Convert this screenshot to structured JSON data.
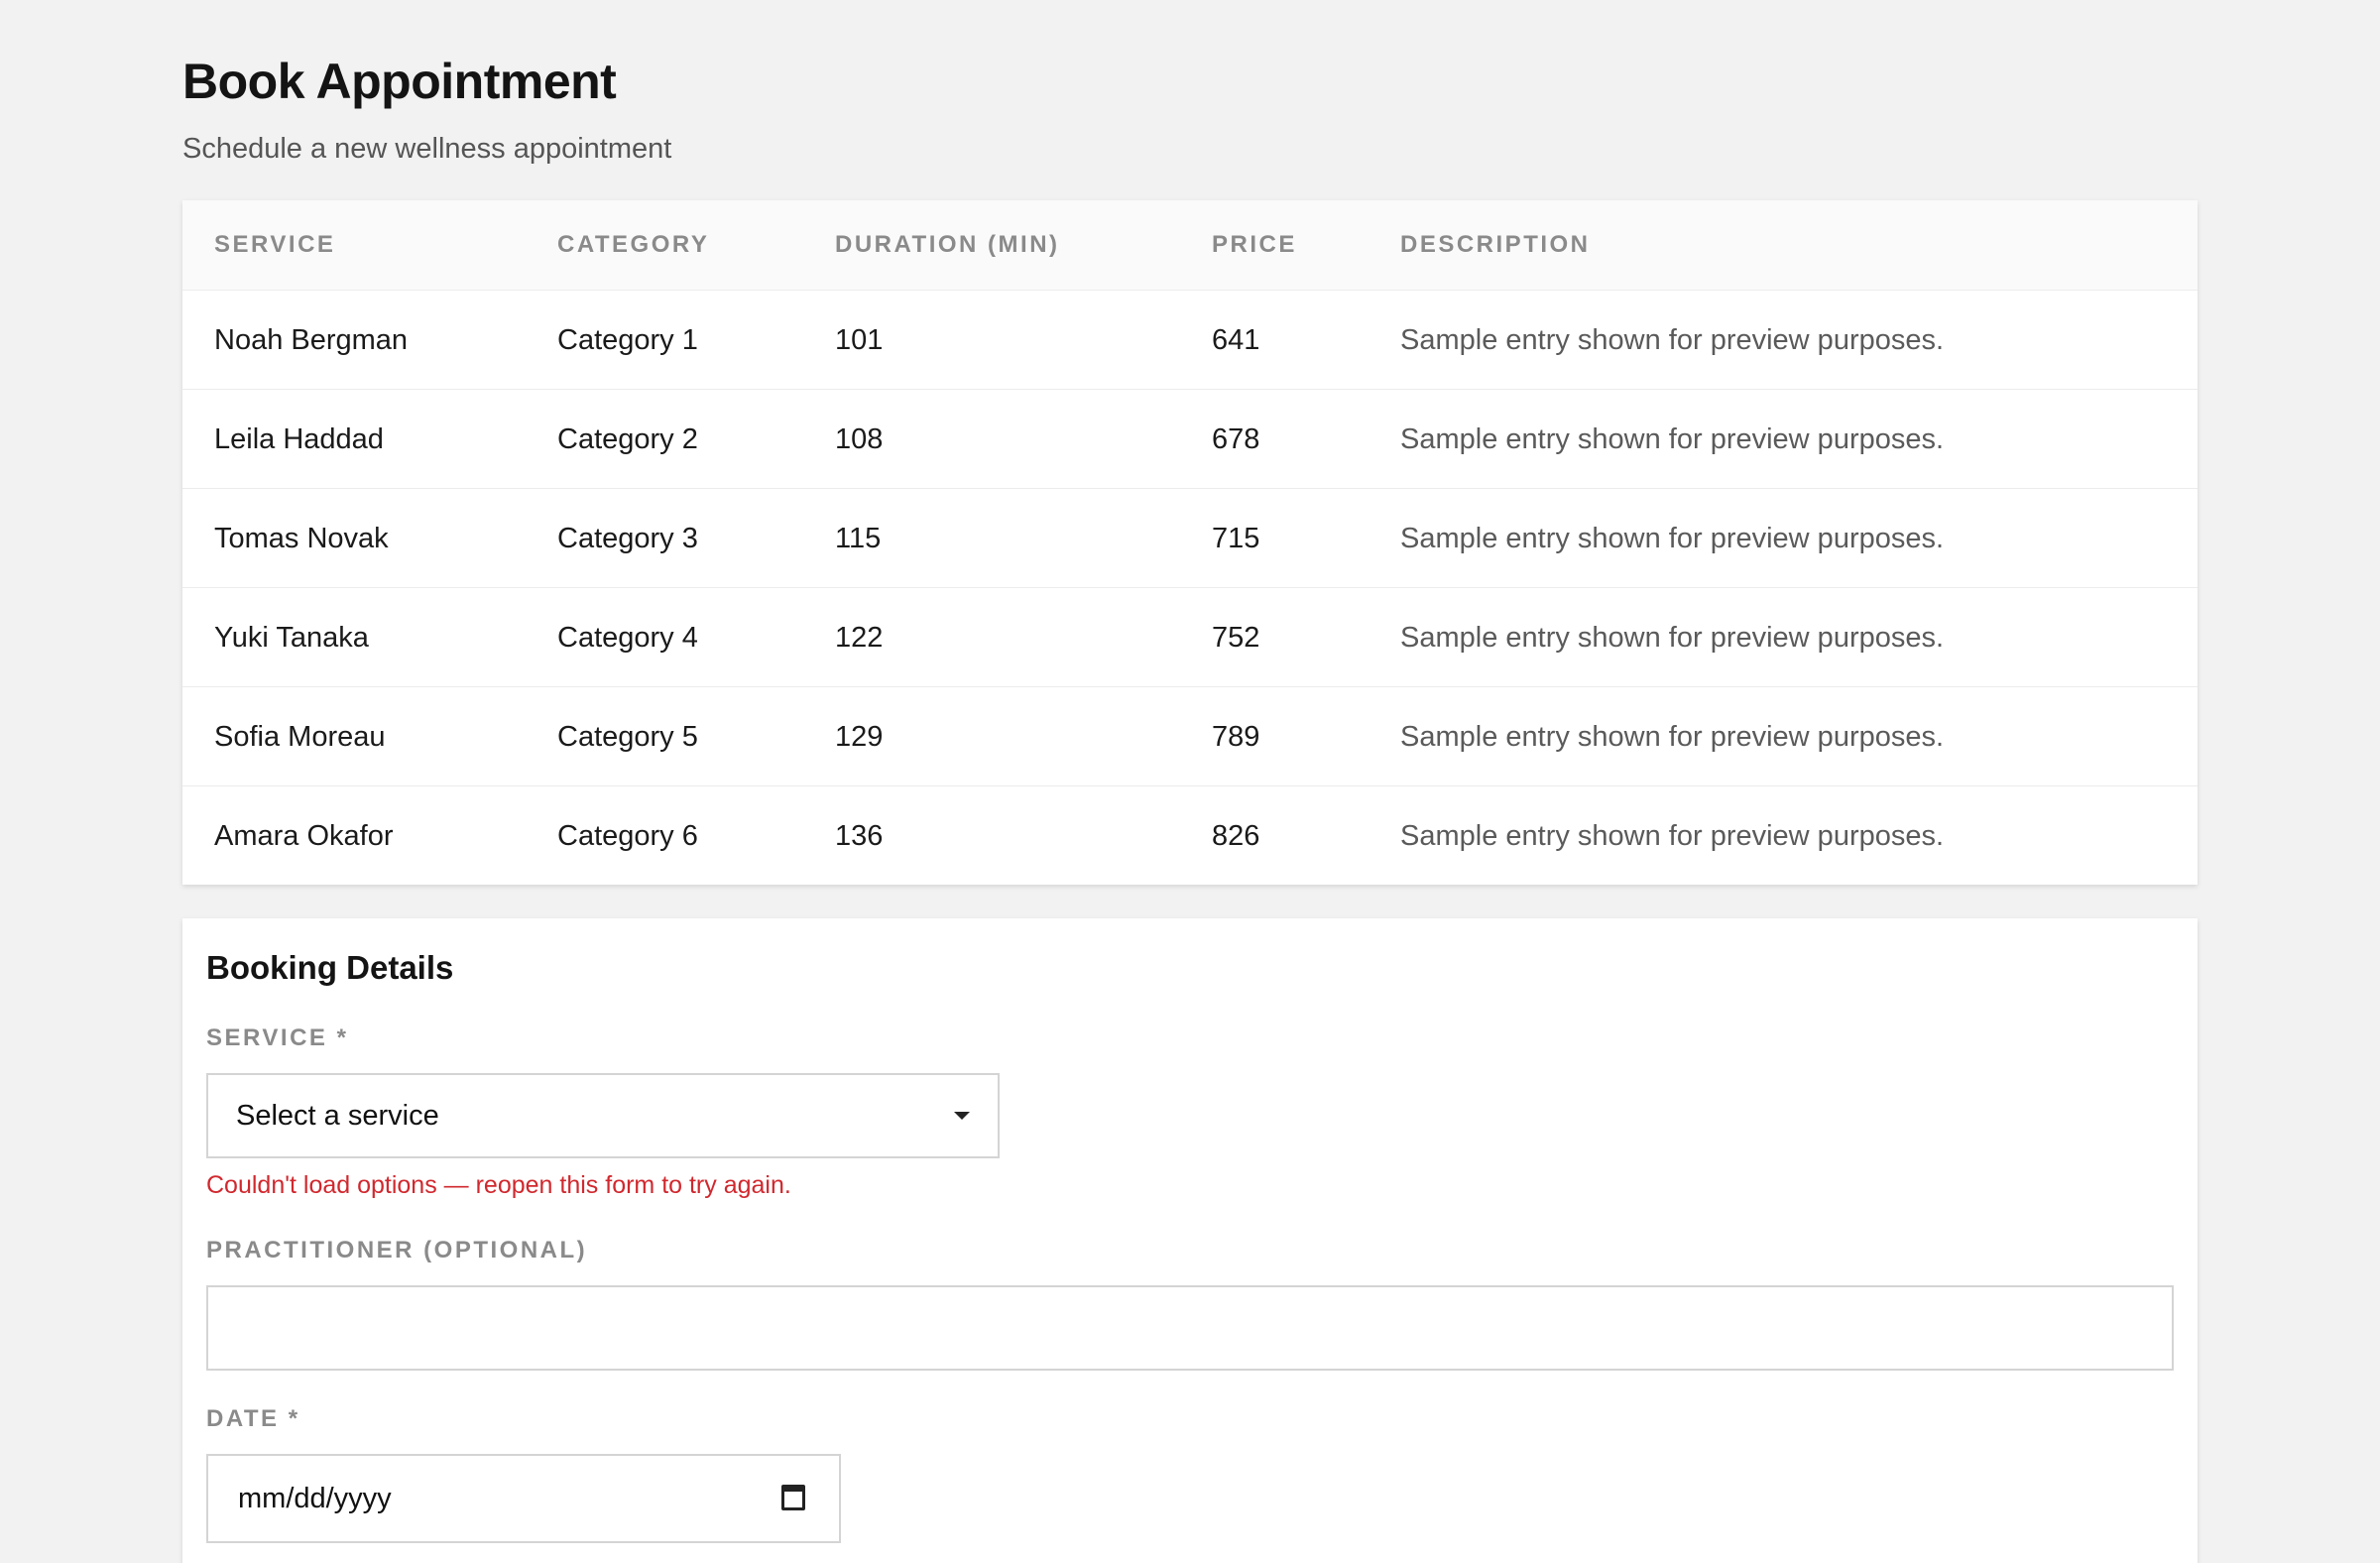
{
  "header": {
    "title": "Book Appointment",
    "subtitle": "Schedule a new wellness appointment"
  },
  "table": {
    "columns": [
      "SERVICE",
      "CATEGORY",
      "DURATION (MIN)",
      "PRICE",
      "DESCRIPTION"
    ],
    "rows": [
      [
        "Noah Bergman",
        "Category 1",
        "101",
        "641",
        "Sample entry shown for preview purposes."
      ],
      [
        "Leila Haddad",
        "Category 2",
        "108",
        "678",
        "Sample entry shown for preview purposes."
      ],
      [
        "Tomas Novak",
        "Category 3",
        "115",
        "715",
        "Sample entry shown for preview purposes."
      ],
      [
        "Yuki Tanaka",
        "Category 4",
        "122",
        "752",
        "Sample entry shown for preview purposes."
      ],
      [
        "Sofia Moreau",
        "Category 5",
        "129",
        "789",
        "Sample entry shown for preview purposes."
      ],
      [
        "Amara Okafor",
        "Category 6",
        "136",
        "826",
        "Sample entry shown for preview purposes."
      ]
    ]
  },
  "form": {
    "title": "Booking Details",
    "service_label": "SERVICE *",
    "service_value": "Select a service",
    "service_error": "Couldn't load options — reopen this form to try again.",
    "practitioner_label": "PRACTITIONER (OPTIONAL)",
    "practitioner_value": "",
    "date_label": "DATE *",
    "date_placeholder": "mm/dd/yyyy"
  },
  "colors": {
    "background": "#f2f2f2",
    "error": "#d0282e",
    "label": "#8a8a8a"
  },
  "icons": {
    "select_caret": "chevron-down-icon",
    "date_picker": "calendar-icon"
  }
}
